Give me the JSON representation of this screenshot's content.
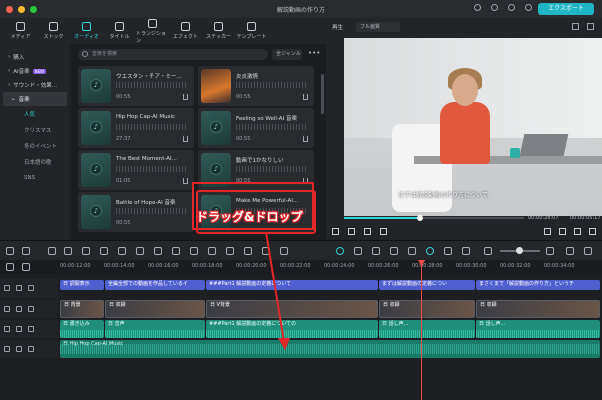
{
  "window": {
    "title": "解説動画の作り方",
    "export_label": "エクスポート"
  },
  "toolbar": {
    "items": [
      "メディア",
      "ストック",
      "オーディオ",
      "タイトル",
      "トランジション",
      "エフェクト",
      "ステッカー",
      "テンプレート"
    ],
    "active": "オーディオ"
  },
  "sidebar": {
    "items": [
      "購入",
      "AI音楽",
      "サウンド・効果...",
      "音楽"
    ],
    "ai_badge": "NEW",
    "subitems": [
      "人気",
      "クリスマス",
      "冬のイベント",
      "日本語の歌",
      "SNS"
    ]
  },
  "library": {
    "search_placeholder": "音楽を検索",
    "sort_label": "全ジャンル",
    "more_label": "•••",
    "cards": [
      {
        "title": "ウエスタン・チア・ミー...",
        "duration": "00:55"
      },
      {
        "title": "炎炎激情",
        "duration": "00:55"
      },
      {
        "title": "Hip Hop Cap-AI Music",
        "duration": "27:37"
      },
      {
        "title": "Feeling so Well-AI 音楽",
        "duration": "00:55"
      },
      {
        "title": "The Best Moment-AI...",
        "duration": "01:05"
      },
      {
        "title": "動画で1かなりしい",
        "duration": "00:55"
      },
      {
        "title": "Battle of Hope-AI 音楽",
        "duration": "00:55"
      },
      {
        "title": "Make Me Powerful-AI...",
        "duration": "00:55"
      }
    ]
  },
  "preview": {
    "label": "再生",
    "quality": "フル画質",
    "subtitle": "まずは解説動画の作り方について、",
    "current_time": "00:00:28:07",
    "total_time": "00:00:05:17",
    "progress": 0.42
  },
  "ruler": {
    "labels": [
      "00:00:12:00",
      "00:00:14:00",
      "00:00:16:00",
      "00:00:18:00",
      "00:00:20:00",
      "00:00:22:00",
      "00:00:24:00",
      "00:00:26:00",
      "00:00:28:00",
      "00:00:30:00",
      "00:00:32:00",
      "00:00:34:00"
    ]
  },
  "timeline": {
    "text_clips": [
      "日 調開表示",
      "全編全部での動画を作品しているイ",
      "###Part1 解説動画の定義について",
      "まずは解説動画の定義につい",
      "まさくまで「解説動画の作り方」というチ"
    ],
    "video_clips": [
      "日 背景",
      "日 収録",
      "日 V背景",
      "日 収録",
      "日 収録"
    ],
    "audio_clips": [
      "日 書き込み",
      "日 音声",
      "###Part1 解説動画の定義についての",
      "日 話し声...",
      "日 話し声..."
    ],
    "music_clip": "日 Hip Hop Cap-AI Music"
  },
  "annotation": {
    "label": "ドラッグ&ドロップ",
    "color": "#e3262a"
  }
}
